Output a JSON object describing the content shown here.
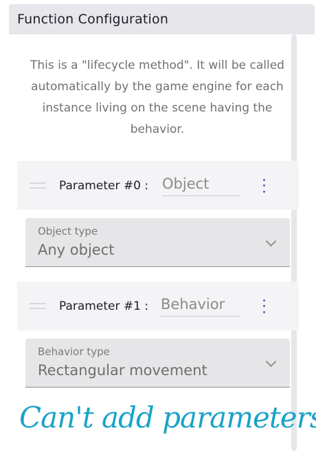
{
  "panel": {
    "title": "Function Configuration",
    "description": "This is a \"lifecycle method\". It will be called automatically by the game engine for each instance living on the scene having the behavior."
  },
  "parameters": [
    {
      "label": "Parameter #0 :",
      "name": "Object",
      "select_label": "Object type",
      "select_value": "Any object"
    },
    {
      "label": "Parameter #1 :",
      "name": "Behavior",
      "select_label": "Behavior type",
      "select_value": "Rectangular movement"
    }
  ],
  "annotation": "Can't add parameters",
  "colors": {
    "header_bg": "#e6e6eb",
    "accent": "#6559b8",
    "annotation": "#1aa3c8"
  },
  "icons": [
    "drag-handle-icon",
    "more-vert-icon",
    "chevron-down-icon"
  ]
}
